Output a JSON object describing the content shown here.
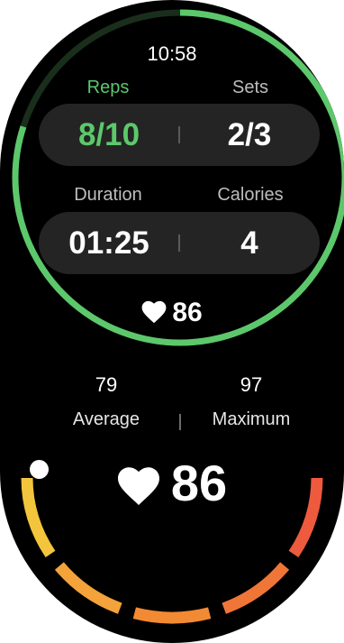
{
  "status": {
    "time": "10:58"
  },
  "workout": {
    "reps_label": "Reps",
    "sets_label": "Sets",
    "reps_value": "8/10",
    "sets_value": "2/3",
    "duration_label": "Duration",
    "calories_label": "Calories",
    "duration_value": "01:25",
    "calories_value": "4",
    "heart_rate": "86",
    "progress_fraction": 0.8
  },
  "heart_rate_detail": {
    "average_value": "79",
    "maximum_value": "97",
    "average_label": "Average",
    "maximum_label": "Maximum",
    "current": "86"
  },
  "colors": {
    "accent_green": "#5cc86b",
    "zone_1": "#f2c53d",
    "zone_2": "#f4a23a",
    "zone_3": "#f28a33",
    "zone_4": "#f07638",
    "zone_5": "#ee5a3e"
  },
  "icons": {
    "heart": "heart-icon"
  }
}
